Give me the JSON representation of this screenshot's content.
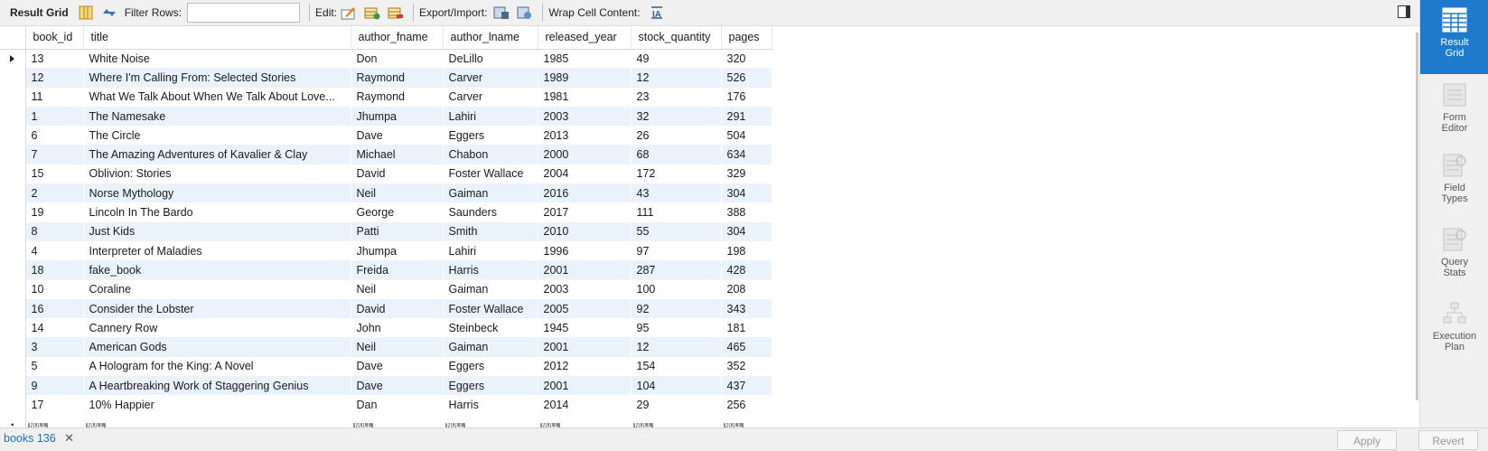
{
  "toolbar": {
    "result_grid_label": "Result Grid",
    "filter_rows_label": "Filter Rows:",
    "filter_rows_value": "",
    "edit_label": "Edit:",
    "export_import_label": "Export/Import:",
    "wrap_cell_label": "Wrap Cell Content:"
  },
  "grid": {
    "columns": [
      "book_id",
      "title",
      "author_fname",
      "author_lname",
      "released_year",
      "stock_quantity",
      "pages"
    ],
    "rows": [
      [
        "13",
        "White Noise",
        "Don",
        "DeLillo",
        "1985",
        "49",
        "320"
      ],
      [
        "12",
        "Where I'm Calling From: Selected Stories",
        "Raymond",
        "Carver",
        "1989",
        "12",
        "526"
      ],
      [
        "11",
        "What We Talk About When We Talk About Love...",
        "Raymond",
        "Carver",
        "1981",
        "23",
        "176"
      ],
      [
        "1",
        "The Namesake",
        "Jhumpa",
        "Lahiri",
        "2003",
        "32",
        "291"
      ],
      [
        "6",
        "The Circle",
        "Dave",
        "Eggers",
        "2013",
        "26",
        "504"
      ],
      [
        "7",
        "The Amazing Adventures of Kavalier & Clay",
        "Michael",
        "Chabon",
        "2000",
        "68",
        "634"
      ],
      [
        "15",
        "Oblivion: Stories",
        "David",
        "Foster Wallace",
        "2004",
        "172",
        "329"
      ],
      [
        "2",
        "Norse Mythology",
        "Neil",
        "Gaiman",
        "2016",
        "43",
        "304"
      ],
      [
        "19",
        "Lincoln In The Bardo",
        "George",
        "Saunders",
        "2017",
        "111",
        "388"
      ],
      [
        "8",
        "Just Kids",
        "Patti",
        "Smith",
        "2010",
        "55",
        "304"
      ],
      [
        "4",
        "Interpreter of Maladies",
        "Jhumpa",
        "Lahiri",
        "1996",
        "97",
        "198"
      ],
      [
        "18",
        "fake_book",
        "Freida",
        "Harris",
        "2001",
        "287",
        "428"
      ],
      [
        "10",
        "Coraline",
        "Neil",
        "Gaiman",
        "2003",
        "100",
        "208"
      ],
      [
        "16",
        "Consider the Lobster",
        "David",
        "Foster Wallace",
        "2005",
        "92",
        "343"
      ],
      [
        "14",
        "Cannery Row",
        "John",
        "Steinbeck",
        "1945",
        "95",
        "181"
      ],
      [
        "3",
        "American Gods",
        "Neil",
        "Gaiman",
        "2001",
        "12",
        "465"
      ],
      [
        "5",
        "A Hologram for the King: A Novel",
        "Dave",
        "Eggers",
        "2012",
        "154",
        "352"
      ],
      [
        "9",
        "A Heartbreaking Work of Staggering Genius",
        "Dave",
        "Eggers",
        "2001",
        "104",
        "437"
      ],
      [
        "17",
        "10% Happier",
        "Dan",
        "Harris",
        "2014",
        "29",
        "256"
      ]
    ],
    "null_label": "NULL",
    "null_columns": [
      0,
      1,
      2,
      3,
      4,
      5,
      6
    ]
  },
  "sidebar": {
    "items": [
      {
        "label": "Result\nGrid",
        "icon": "result-grid-icon",
        "active": true
      },
      {
        "label": "Form\nEditor",
        "icon": "form-editor-icon",
        "active": false
      },
      {
        "label": "Field\nTypes",
        "icon": "field-types-icon",
        "active": false
      },
      {
        "label": "Query\nStats",
        "icon": "query-stats-icon",
        "active": false
      },
      {
        "label": "Execution\nPlan",
        "icon": "execution-plan-icon",
        "active": false
      }
    ]
  },
  "bottom": {
    "tab_label": "books 136",
    "apply_label": "Apply",
    "revert_label": "Revert"
  },
  "colors": {
    "accent": "#1f7acc",
    "row_alt": "#eaf2fb",
    "toolbar_bg": "#f0f0f0"
  }
}
